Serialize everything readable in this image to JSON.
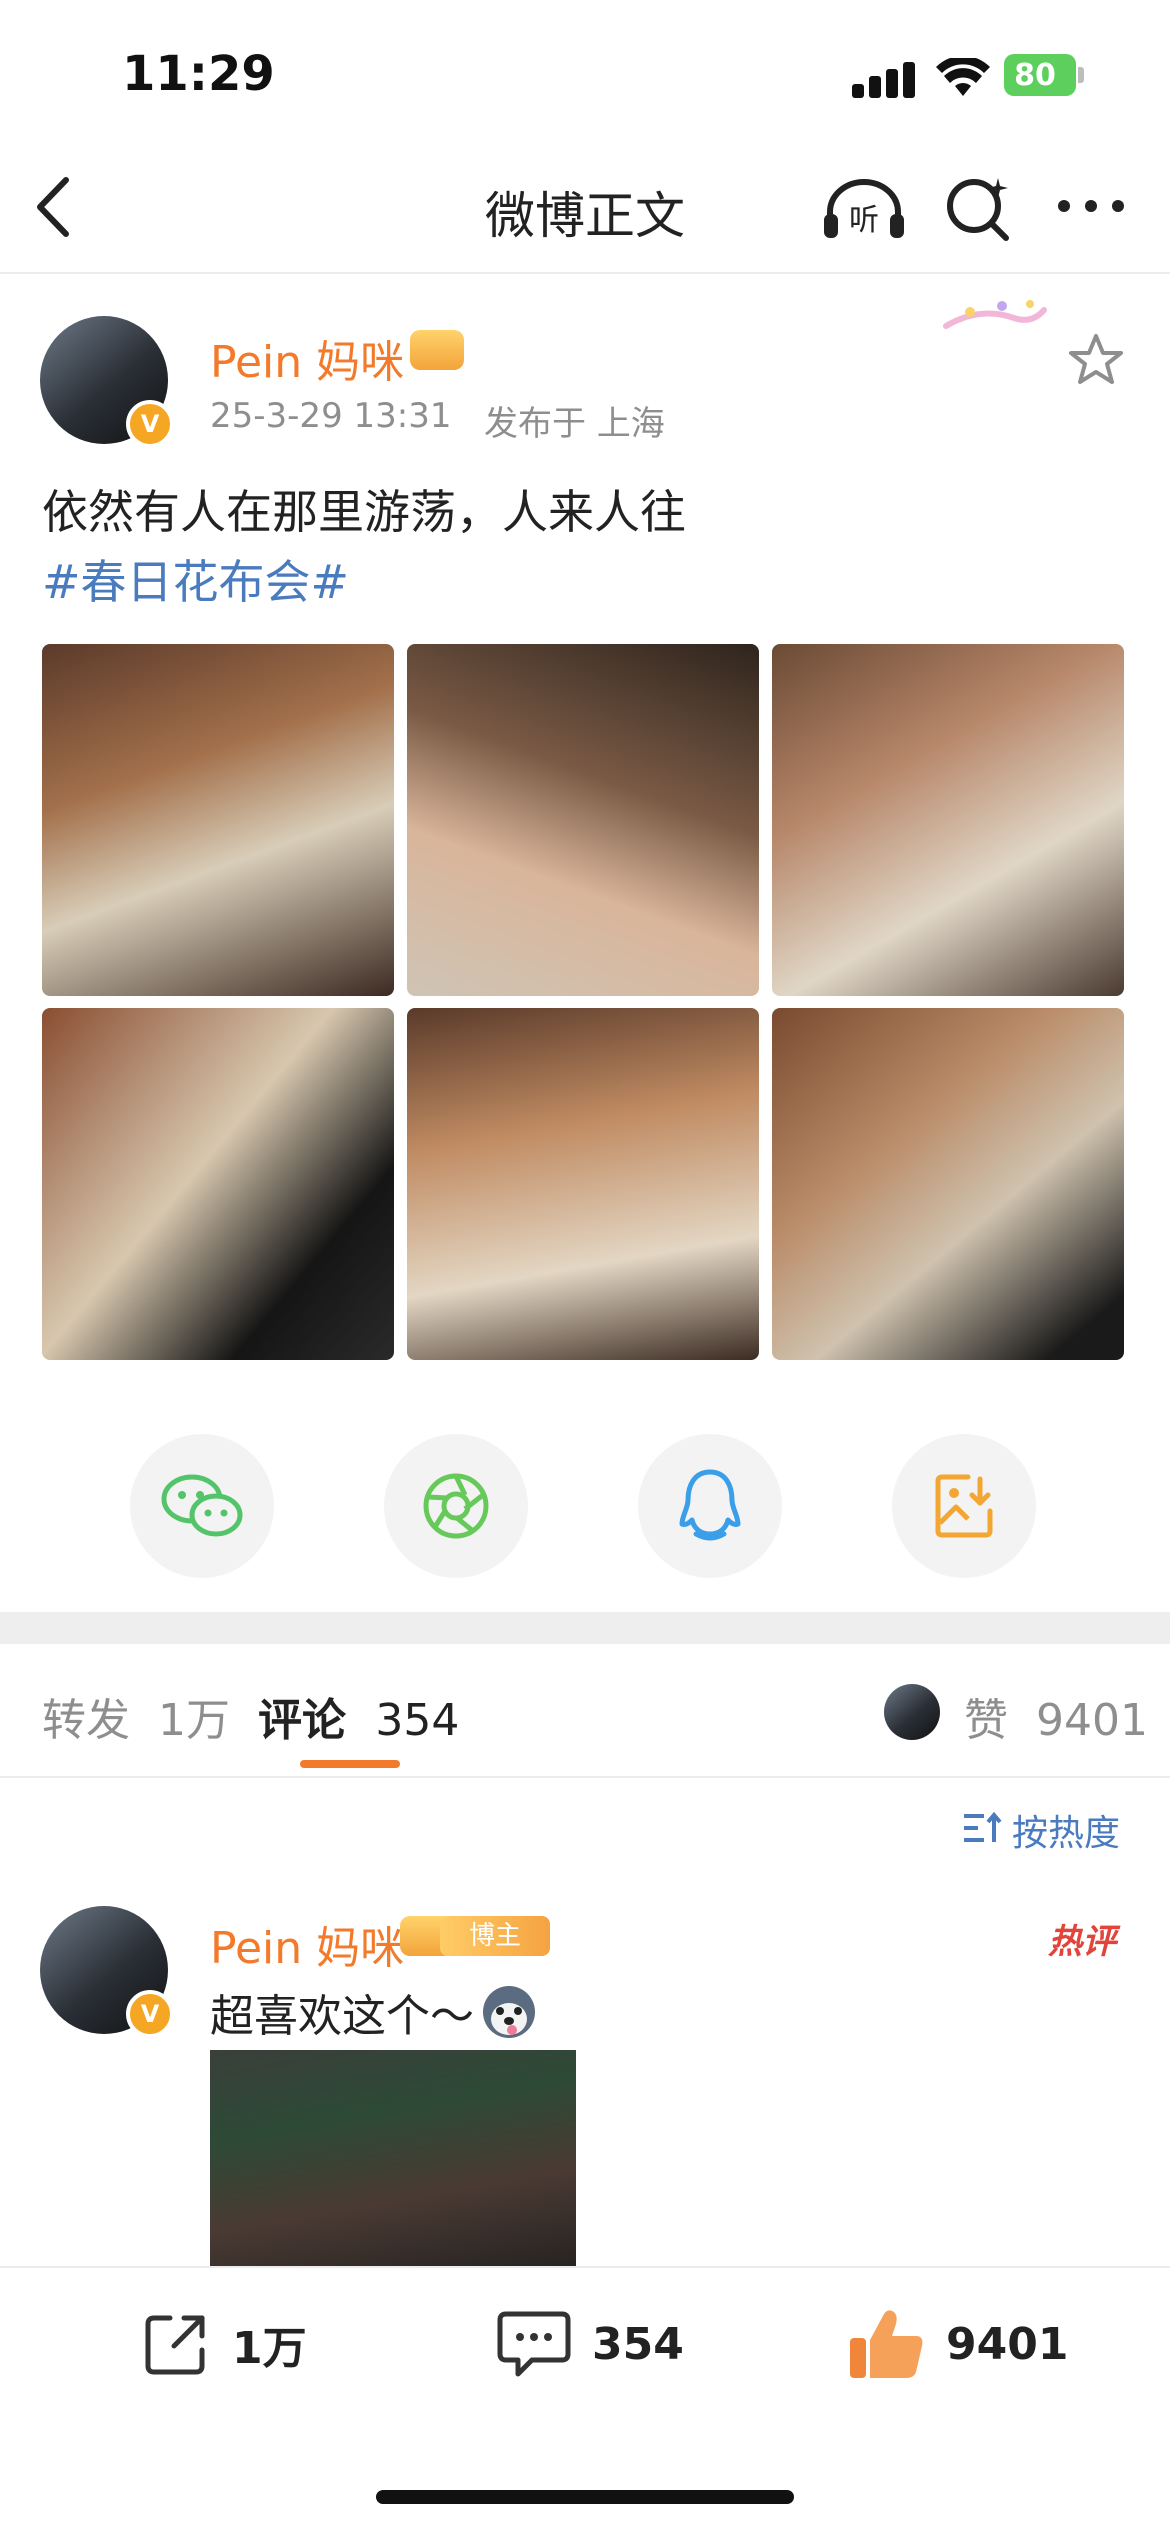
{
  "status_bar": {
    "time": "11:29",
    "battery": "80"
  },
  "nav": {
    "title": "微博正文"
  },
  "post": {
    "author": "Pein 妈咪",
    "timestamp": "25-3-29 13:31",
    "location": "发布于 上海",
    "text": "依然有人在那里游荡，人来人往",
    "hashtag": "#春日花布会#"
  },
  "tabs": {
    "repost_label": "转发",
    "repost_count": "1万",
    "comment_label": "评论",
    "comment_count": "354",
    "like_label": "赞",
    "like_count": "9401"
  },
  "comments": {
    "sort_label": "按热度",
    "first": {
      "author": "Pein 妈咪",
      "badge": "博主",
      "hot_label": "热评",
      "text": "超喜欢这个～"
    }
  },
  "actions": {
    "repost": "1万",
    "comment": "354",
    "like": "9401"
  },
  "colors": {
    "accent": "#f37a2a",
    "link": "#4a7bbf",
    "hot": "#e2433b"
  },
  "icons": [
    "back-icon",
    "headphones-icon",
    "search-icon",
    "more-icon",
    "star-icon",
    "wechat-icon",
    "moments-icon",
    "qq-icon",
    "save-image-icon",
    "sort-icon",
    "repost-icon",
    "comment-icon",
    "like-icon"
  ]
}
